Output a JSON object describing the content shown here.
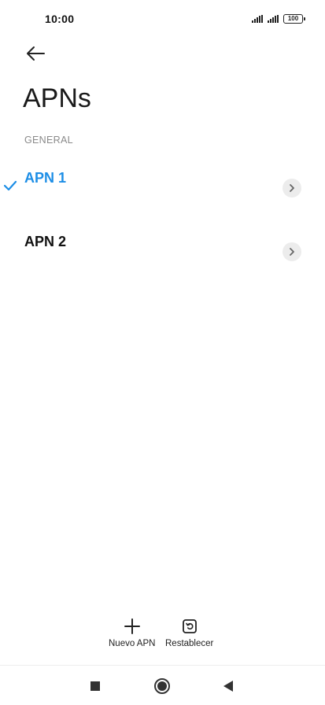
{
  "status_bar": {
    "time": "10:00",
    "battery": "100",
    "icons": [
      "signal-icon",
      "signal-icon",
      "battery-icon"
    ]
  },
  "header": {
    "back_icon": "back-arrow-icon",
    "title": "APNs"
  },
  "section": {
    "header": "GENERAL"
  },
  "apns": [
    {
      "label": "APN 1",
      "selected": true,
      "color": "#1d8ee6",
      "chevron_icon": "chevron-right-icon"
    },
    {
      "label": "APN 2",
      "selected": false,
      "color": "#111111",
      "chevron_icon": "chevron-right-icon"
    }
  ],
  "actions": {
    "new_apn": {
      "label": "Nuevo APN",
      "icon": "plus-icon"
    },
    "reset": {
      "label": "Restablecer",
      "icon": "reset-icon"
    }
  },
  "navbar": {
    "recents_icon": "recents-icon",
    "home_icon": "home-icon",
    "back_icon": "back-triangle-icon"
  },
  "colors": {
    "accent": "#1d8ee6",
    "text": "#111111",
    "muted": "#8a8a8a"
  }
}
